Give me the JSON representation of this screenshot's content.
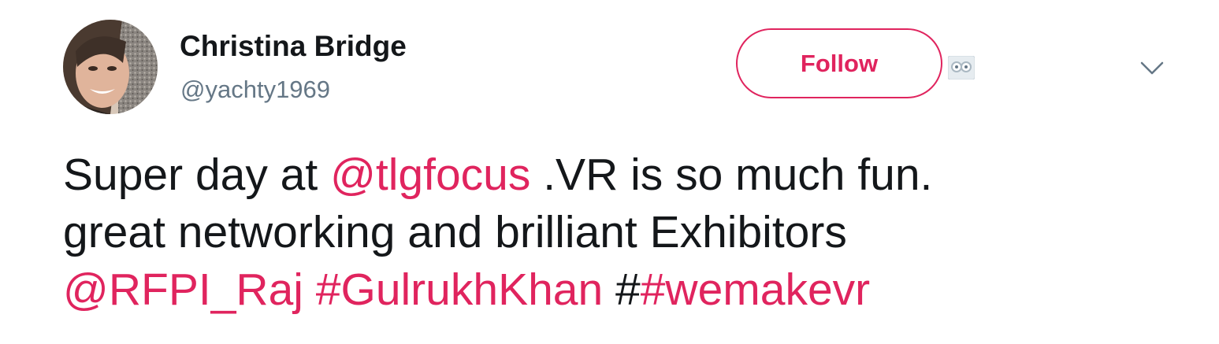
{
  "user": {
    "name": "Christina Bridge",
    "handle": "@yachty1969"
  },
  "follow_button": {
    "label": "Follow"
  },
  "tweet": {
    "line1": {
      "pre": "Super day at ",
      "mention": "@tlgfocus",
      "post": " .VR is so much fun."
    },
    "line2": {
      "text": "great networking and brilliant Exhibitors"
    },
    "line3": {
      "mention": "@RFPI_Raj",
      "sep1": " ",
      "hashtag1": "#GulrukhKhan",
      "sep2": " #",
      "hashtag2": "#wemakevr"
    }
  },
  "icons": {
    "avatar": "profile-photo",
    "badge": "owl-glasses-icon",
    "menu": "chevron-down-icon"
  },
  "colors": {
    "accent": "#e0245e",
    "text": "#14171a",
    "secondary": "#657786",
    "caret": "#657786"
  }
}
